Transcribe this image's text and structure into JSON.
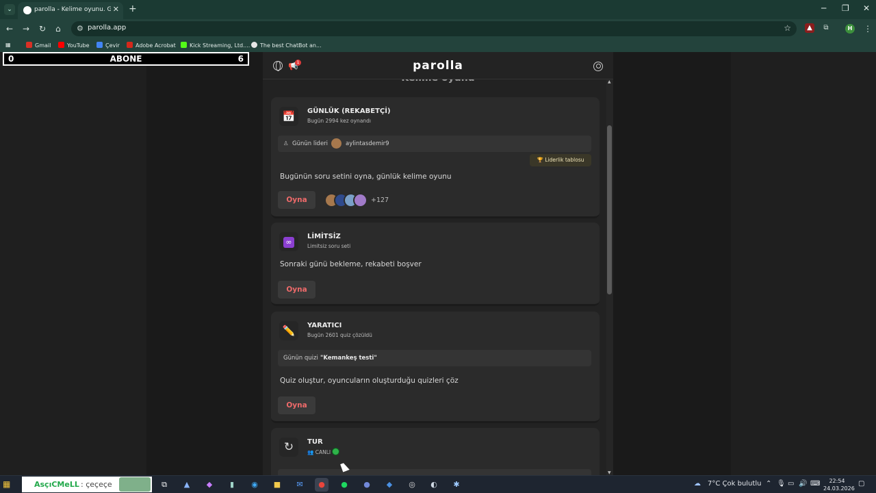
{
  "browser": {
    "tab_title": "parolla - Kelime oyunu. Günlük",
    "url": "parolla.app",
    "bookmarks": [
      "Gmail",
      "YouTube",
      "Çevir",
      "Adobe Acrobat",
      "Kick Streaming, Ltd....",
      "The best ChatBot an..."
    ],
    "profile_initial": "H"
  },
  "overlay": {
    "left": "0",
    "center": "ABONE",
    "right": "6"
  },
  "app": {
    "logo": "parolla",
    "page_title": "Kelime oyunu",
    "notification_count": "1"
  },
  "cards": {
    "daily": {
      "title": "GÜNLÜK (REKABETÇİ)",
      "subtitle": "Bugün 2994 kez oynandı",
      "leader_label": "Günün lideri",
      "leader_name": "aylintasdemir9",
      "leaderboard": "Liderlik tablosu",
      "description": "Bugünün soru setini oyna, günlük kelime oyunu",
      "play": "Oyna",
      "more_players": "+127"
    },
    "unlimited": {
      "title": "LİMİTSİZ",
      "subtitle": "Limitsiz soru seti",
      "description": "Sonraki günü bekleme, rekabeti boşver",
      "play": "Oyna"
    },
    "creative": {
      "title": "YARATICI",
      "subtitle": "Bugün 2601 quiz çözüldü",
      "quiz_label": "Günün quizi",
      "quiz_name": "\"Kemankeş testi\"",
      "description": "Quiz oluştur, oyuncuların oluşturduğu quizleri çöz",
      "play": "Oyna"
    },
    "tour": {
      "title": "TUR",
      "status": "CANLI"
    }
  },
  "taskbar": {
    "search_brand": "AsçıCMeLL",
    "search_text": ": çeçeçe",
    "weather": "7°C  Çok bulutlu",
    "time": "22:54",
    "date": "24.03.2026"
  }
}
